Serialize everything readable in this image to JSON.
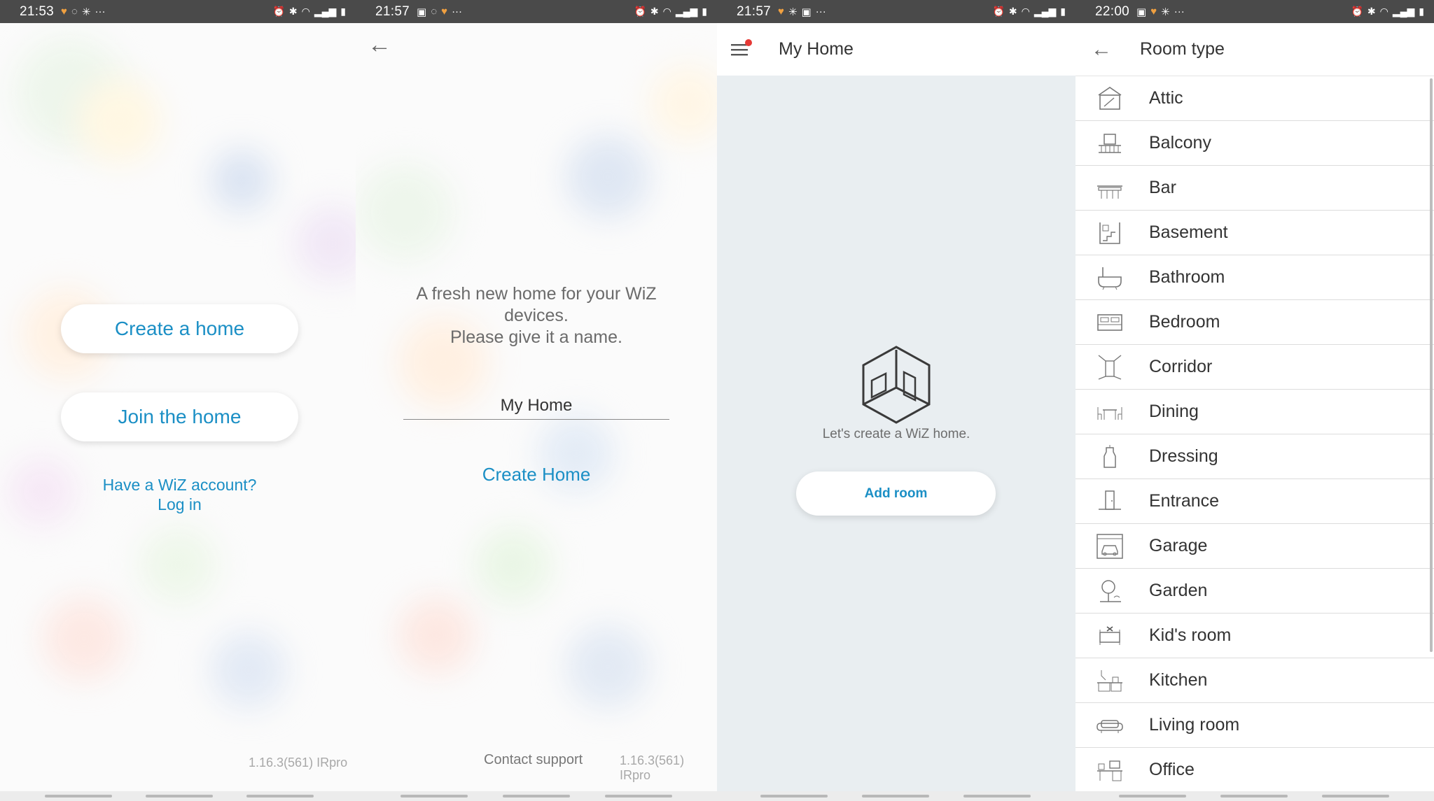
{
  "status_bars": [
    {
      "time": "21:53"
    },
    {
      "time": "21:57"
    },
    {
      "time": "21:57"
    },
    {
      "time": "22:00"
    }
  ],
  "panel1": {
    "create_home_label": "Create a home",
    "join_home_label": "Join the home",
    "account_question": "Have a WiZ account?",
    "login_label": "Log in",
    "version": "1.16.3(561) IRpro"
  },
  "panel2": {
    "intro_line1": "A fresh new home for your WiZ",
    "intro_line2": "devices.",
    "intro_line3": "Please give it a name.",
    "home_name_value": "My Home",
    "create_home_label": "Create Home",
    "contact_support_label": "Contact support",
    "version": "1.16.3(561) IRpro"
  },
  "panel3": {
    "title": "My Home",
    "empty_caption": "Let's create a WiZ home.",
    "add_room_label": "Add room"
  },
  "panel4": {
    "title": "Room type",
    "rooms": [
      {
        "label": "Attic",
        "icon": "attic-icon"
      },
      {
        "label": "Balcony",
        "icon": "balcony-icon"
      },
      {
        "label": "Bar",
        "icon": "bar-icon"
      },
      {
        "label": "Basement",
        "icon": "basement-icon"
      },
      {
        "label": "Bathroom",
        "icon": "bathroom-icon"
      },
      {
        "label": "Bedroom",
        "icon": "bedroom-icon"
      },
      {
        "label": "Corridor",
        "icon": "corridor-icon"
      },
      {
        "label": "Dining",
        "icon": "dining-icon"
      },
      {
        "label": "Dressing",
        "icon": "dressing-icon"
      },
      {
        "label": "Entrance",
        "icon": "entrance-icon"
      },
      {
        "label": "Garage",
        "icon": "garage-icon"
      },
      {
        "label": "Garden",
        "icon": "garden-icon"
      },
      {
        "label": "Kid's room",
        "icon": "kids-room-icon"
      },
      {
        "label": "Kitchen",
        "icon": "kitchen-icon"
      },
      {
        "label": "Living room",
        "icon": "living-room-icon"
      },
      {
        "label": "Office",
        "icon": "office-icon"
      }
    ]
  },
  "colors": {
    "accent": "#1b8fc5",
    "status_bar": "#4a4a4a",
    "notification_dot": "#e53935"
  }
}
